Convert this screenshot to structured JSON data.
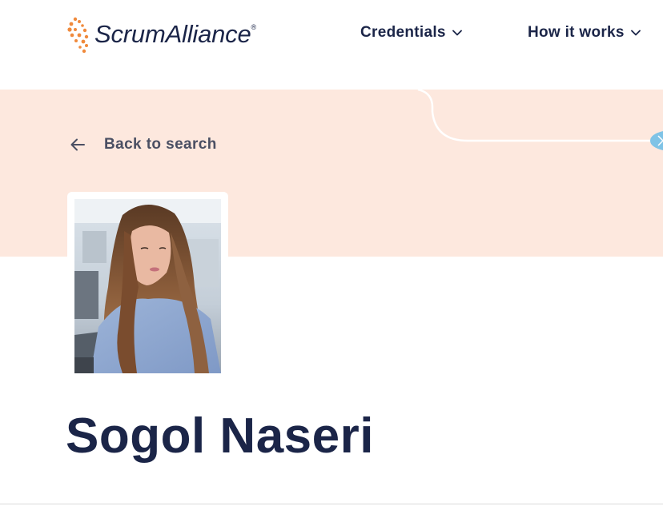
{
  "brand": {
    "name": "ScrumAlliance",
    "registered_mark": "®",
    "orange": "#f08a3c",
    "navy": "#1b2548"
  },
  "nav": {
    "items": [
      {
        "label": "Credentials",
        "icon": "chevron-down-icon"
      },
      {
        "label": "How it works",
        "icon": "chevron-down-icon"
      }
    ]
  },
  "banner": {
    "background": "#fde8de",
    "back_label": "Back to search",
    "back_icon": "arrow-left-icon"
  },
  "profile": {
    "name": "Sogol Naseri",
    "photo_icon": "profile-photo"
  }
}
